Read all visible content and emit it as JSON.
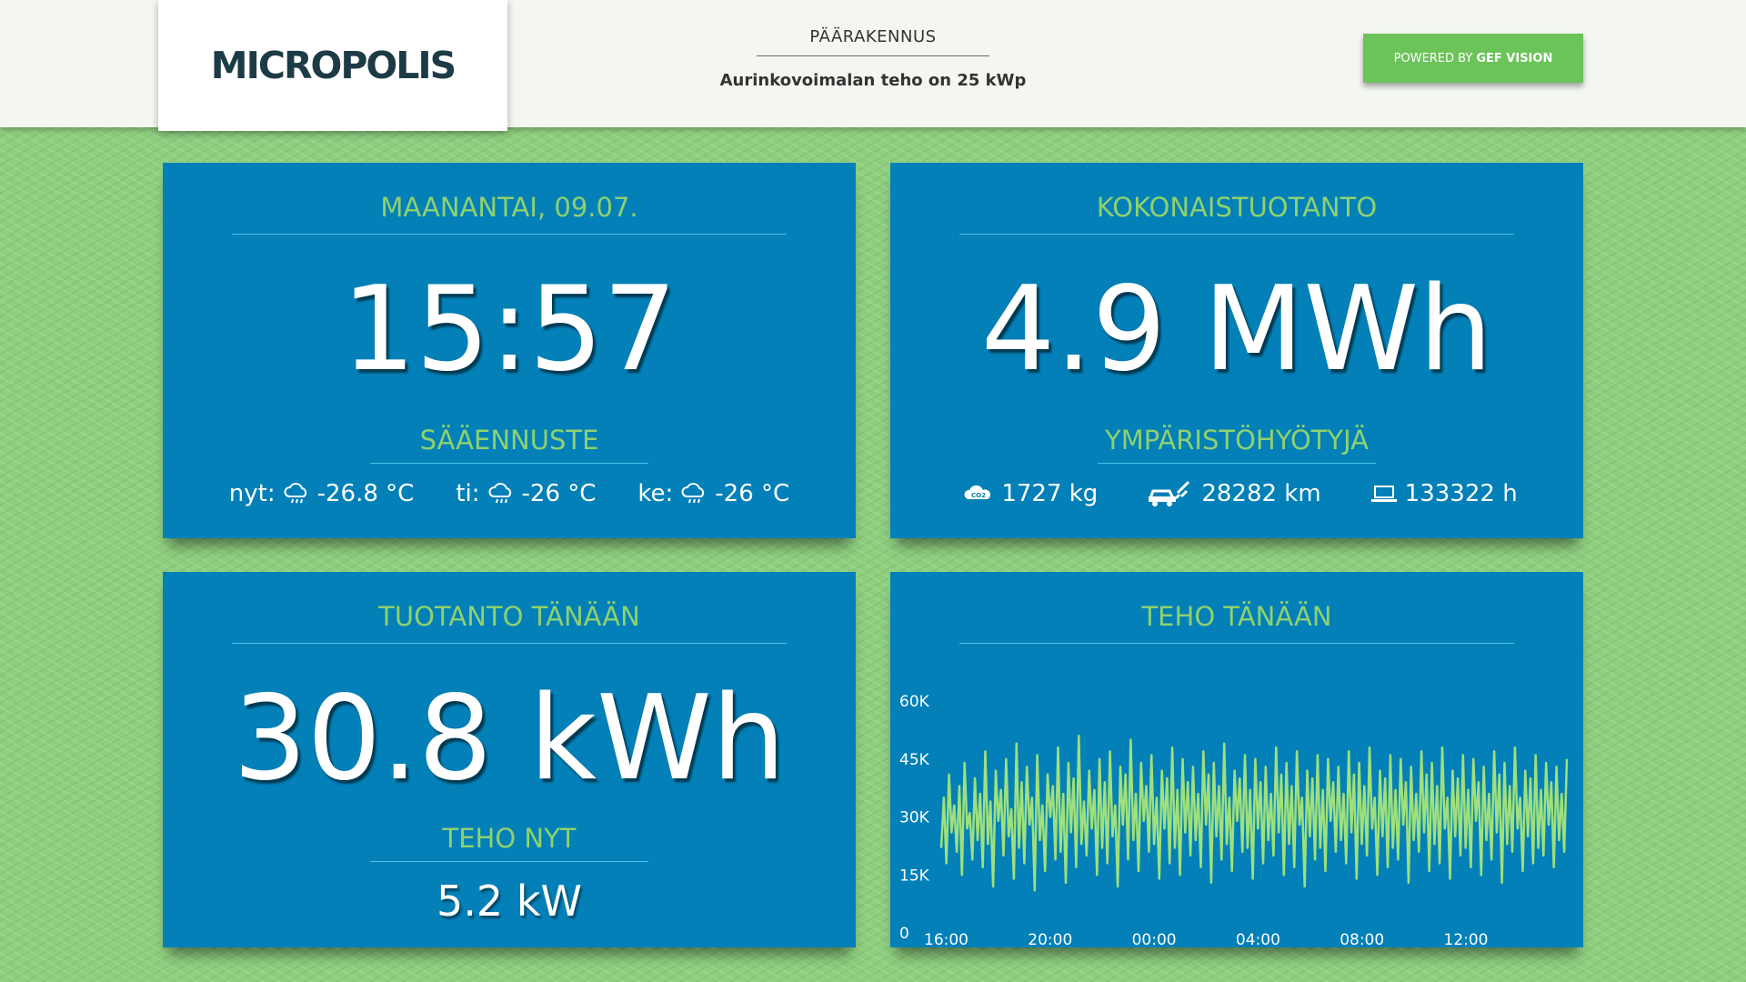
{
  "header": {
    "logo": "MICROPOLIS",
    "site_title": "PÄÄRAKENNUS",
    "site_subtitle": "Aurinkovoimalan teho on 25 kWp",
    "powered_prefix": "POWERED BY",
    "powered_brand": "GEF VISION"
  },
  "clock_panel": {
    "title": "MAANANTAI, 09.07.",
    "time": "15:57",
    "forecast_title": "SÄÄENNUSTE",
    "forecast": [
      {
        "label": "nyt:",
        "value": "-26.8 °C",
        "icon": "cloud-rain-icon"
      },
      {
        "label": "ti:",
        "value": "-26 °C",
        "icon": "cloud-rain-icon"
      },
      {
        "label": "ke:",
        "value": "-26 °C",
        "icon": "cloud-rain-icon"
      }
    ]
  },
  "total_panel": {
    "title": "KOKONAISTUOTANTO",
    "value": "4.9 MWh",
    "benefits_title": "YMPÄRISTÖHYÖTYJÄ",
    "benefits": [
      {
        "value": "1727 kg",
        "icon": "co2-cloud-icon"
      },
      {
        "value": "28282 km",
        "icon": "electric-car-icon"
      },
      {
        "value": "133322 h",
        "icon": "laptop-icon"
      }
    ]
  },
  "today_panel": {
    "title": "TUOTANTO TÄNÄÄN",
    "value": "30.8 kWh",
    "power_title": "TEHO NYT",
    "power_value": "5.2 kW"
  },
  "chart_panel": {
    "title": "TEHO TÄNÄÄN"
  },
  "colors": {
    "panel": "#0280b7",
    "accent_green": "#8fd16e",
    "line": "#9fe07c",
    "background": "#8ecf7e"
  },
  "chart_data": {
    "type": "line",
    "title": "TEHO TÄNÄÄN",
    "xlabel": "",
    "ylabel": "",
    "ylim": [
      0,
      60000
    ],
    "y_ticks": [
      "0",
      "15K",
      "30K",
      "45K",
      "60K"
    ],
    "x_ticks": [
      "16:00",
      "20:00",
      "00:00",
      "04:00",
      "08:00",
      "12:00"
    ],
    "x_range_hours": [
      0,
      24
    ],
    "series": [
      {
        "values": [
          22000,
          35000,
          18000,
          41000,
          26000,
          33000,
          21000,
          38000,
          15000,
          44000,
          27000,
          31000,
          19000,
          40000,
          24000,
          36000,
          17000,
          47000,
          23000,
          34000,
          12000,
          42000,
          29000,
          37000,
          20000,
          45000,
          25000,
          32000,
          14000,
          49000,
          22000,
          39000,
          18000,
          43000,
          28000,
          35000,
          11000,
          46000,
          24000,
          33000,
          16000,
          41000,
          30000,
          38000,
          19000,
          48000,
          21000,
          36000,
          13000,
          44000,
          26000,
          40000,
          17000,
          51000,
          23000,
          34000,
          20000,
          42000,
          27000,
          37000,
          15000,
          45000,
          22000,
          39000,
          18000,
          47000,
          25000,
          33000,
          12000,
          43000,
          28000,
          41000,
          19000,
          50000,
          24000,
          36000,
          16000,
          44000,
          29000,
          38000,
          21000,
          46000,
          23000,
          35000,
          14000,
          42000,
          27000,
          40000,
          18000,
          48000,
          22000,
          37000,
          15000,
          45000,
          26000,
          39000,
          20000,
          43000,
          24000,
          36000,
          17000,
          47000,
          28000,
          41000,
          13000,
          44000,
          25000,
          38000,
          19000,
          49000,
          23000,
          35000,
          16000,
          42000,
          29000,
          40000,
          21000,
          46000,
          22000,
          37000,
          14000,
          45000,
          27000,
          39000,
          18000,
          43000,
          24000,
          36000,
          20000,
          48000,
          26000,
          41000,
          15000,
          44000,
          23000,
          38000,
          17000,
          47000,
          28000,
          35000,
          12000,
          42000,
          25000,
          40000,
          19000,
          46000,
          22000,
          37000,
          16000,
          45000,
          29000,
          39000,
          21000,
          43000,
          24000,
          36000,
          18000,
          47000,
          26000,
          41000,
          14000,
          44000,
          23000,
          38000,
          20000,
          48000,
          27000,
          35000,
          15000,
          42000,
          25000,
          40000,
          17000,
          46000,
          22000,
          37000,
          19000,
          45000,
          28000,
          39000,
          13000,
          43000,
          24000,
          36000,
          21000,
          47000,
          26000,
          41000,
          16000,
          44000,
          23000,
          38000,
          18000,
          48000,
          27000,
          35000,
          14000,
          42000,
          25000,
          40000,
          20000,
          46000,
          22000,
          37000,
          17000,
          45000,
          29000,
          39000,
          15000,
          43000,
          24000,
          36000,
          19000,
          47000,
          26000,
          41000,
          13000,
          44000,
          23000,
          38000,
          21000,
          48000,
          27000,
          35000,
          16000,
          42000,
          25000,
          40000,
          18000,
          46000,
          22000,
          37000,
          20000,
          44000,
          28000,
          39000,
          17000,
          43000,
          24000,
          36000,
          21000,
          45000
        ]
      }
    ]
  }
}
